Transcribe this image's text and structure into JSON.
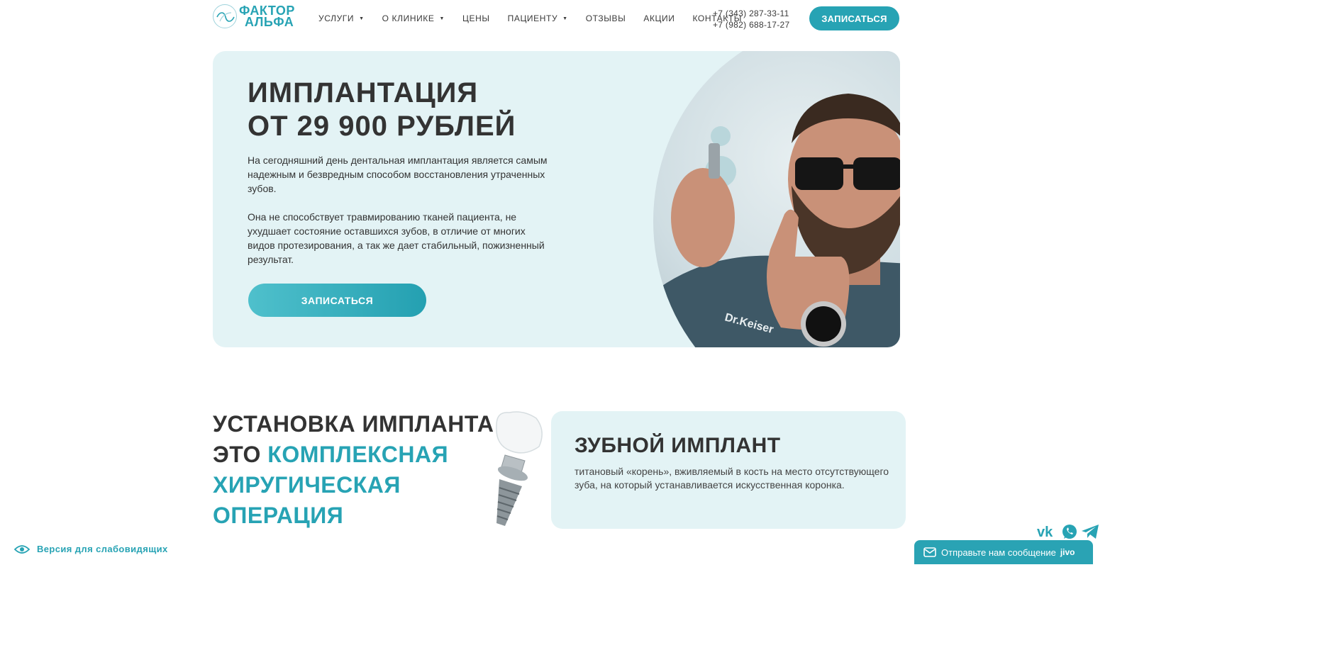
{
  "header": {
    "logo_line1": "ФАКТОР",
    "logo_line2": "АЛЬФА",
    "nav": [
      {
        "label": "УСЛУГИ",
        "has_dropdown": true
      },
      {
        "label": "О КЛИНИКЕ",
        "has_dropdown": true
      },
      {
        "label": "ЦЕНЫ",
        "has_dropdown": false
      },
      {
        "label": "ПАЦИЕНТУ",
        "has_dropdown": true
      },
      {
        "label": "ОТЗЫВЫ",
        "has_dropdown": false
      },
      {
        "label": "АКЦИИ",
        "has_dropdown": false
      },
      {
        "label": "КОНТАКТЫ",
        "has_dropdown": false
      }
    ],
    "phone1": "+7 (343) 287-33-11",
    "phone2": "+7 (982) 688-17-27",
    "cta_label": "ЗАПИСАТЬСЯ"
  },
  "hero": {
    "title_line1": "ИМПЛАНТАЦИЯ",
    "title_line2": "ОТ 29 900 РУБЛЕЙ",
    "paragraph1": "На сегодняшний день дентальная имплантация является самым надежным и безвредным способом восстановления утраченных зубов.",
    "paragraph2": "Она не способствует травмированию тканей пациента, не ухудшает состояние оставшихся зубов, в отличие от многих видов протезирования, а так же дает стабильный, пожизненный результат.",
    "cta_label": "ЗАПИСАТЬСЯ",
    "photo_badge": "Dr.Keiser"
  },
  "section": {
    "title_plain1": "УСТАНОВКА ИМПЛАНТА —",
    "title_plain2": "ЭТО ",
    "title_accent1": "КОМПЛЕКСНАЯ",
    "title_accent2": "ХИРУГИЧЕСКАЯ",
    "title_accent3": "ОПЕРАЦИЯ",
    "card_title": "ЗУБНОЙ ИМПЛАНТ",
    "card_text": "титановый «корень», вживляемый в кость на место отсутствующего зуба, на который устанавливается искусственная коронка."
  },
  "widgets": {
    "accessibility_label": "Версия для слабовидящих",
    "chat_label": "Отправьте нам сообщение",
    "chat_brand": "jivo",
    "social_icons": [
      "vk-icon",
      "whatsapp-icon",
      "telegram-icon"
    ]
  },
  "colors": {
    "accent": "#27a3b4",
    "hero_bg": "#e3f3f5",
    "text": "#333333"
  }
}
